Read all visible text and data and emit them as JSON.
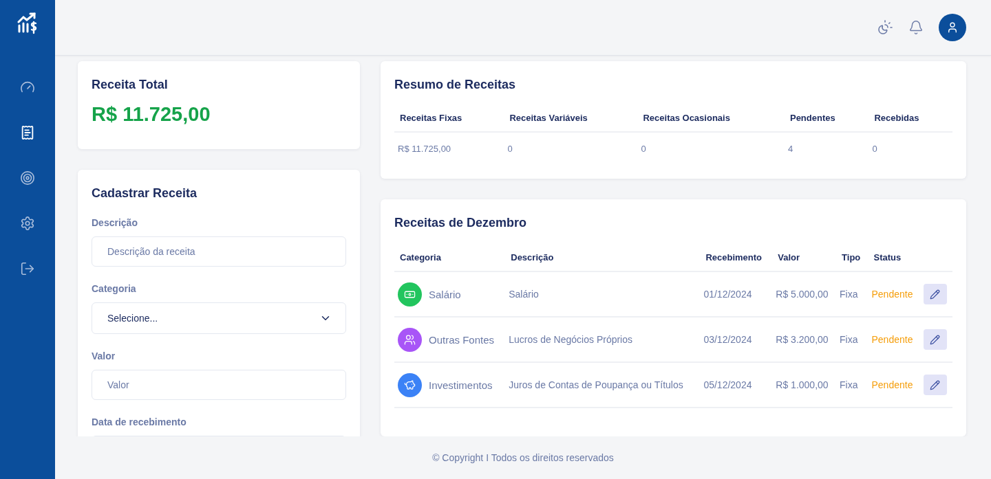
{
  "sidebar": {
    "items": [
      {
        "kind": "dashboard",
        "selected": false
      },
      {
        "kind": "receipts",
        "selected": true
      },
      {
        "kind": "goals",
        "selected": false
      },
      {
        "kind": "settings",
        "selected": false
      },
      {
        "kind": "logout",
        "selected": false
      }
    ]
  },
  "total_card": {
    "title": "Receita Total",
    "amount": "R$ 11.725,00"
  },
  "form": {
    "title": "Cadastrar Receita",
    "fields": [
      {
        "kind": "text",
        "label": "Descrição",
        "placeholder": "Descrição da receita"
      },
      {
        "kind": "select",
        "label": "Categoria",
        "value": "Selecione..."
      },
      {
        "kind": "text",
        "label": "Valor",
        "placeholder": "Valor"
      },
      {
        "kind": "date",
        "label": "Data de recebimento"
      }
    ]
  },
  "summary": {
    "title": "Resumo de Receitas",
    "columns": [
      "Receitas Fixas",
      "Receitas Variáveis",
      "Receitas Ocasionais",
      "Pendentes",
      "Recebidas"
    ],
    "values": [
      "R$ 11.725,00",
      "0",
      "0",
      "4",
      "0"
    ]
  },
  "month_table": {
    "title": "Receitas de Dezembro",
    "columns": [
      "Categoria",
      "Descrição",
      "Recebimento",
      "Valor",
      "Tipo",
      "Status"
    ],
    "rows": [
      {
        "category": "Salário",
        "kind": "money",
        "color": "#22c55e",
        "description": "Salário",
        "date": "01/12/2024",
        "value": "R$ 5.000,00",
        "type": "Fixa",
        "status": "Pendente"
      },
      {
        "category": "Outras Fontes",
        "kind": "people",
        "color": "#a855f7",
        "description": "Lucros de Negócios Próprios",
        "date": "03/12/2024",
        "value": "R$ 3.200,00",
        "type": "Fixa",
        "status": "Pendente"
      },
      {
        "category": "Investimentos",
        "kind": "piggy",
        "color": "#3b82f6",
        "description": "Juros de Contas de Poupança ou Títulos",
        "date": "05/12/2024",
        "value": "R$ 1.000,00",
        "type": "Fixa",
        "status": "Pendente"
      }
    ]
  },
  "footer": {
    "text": "© Copyright I Todos os direitos reservados"
  }
}
